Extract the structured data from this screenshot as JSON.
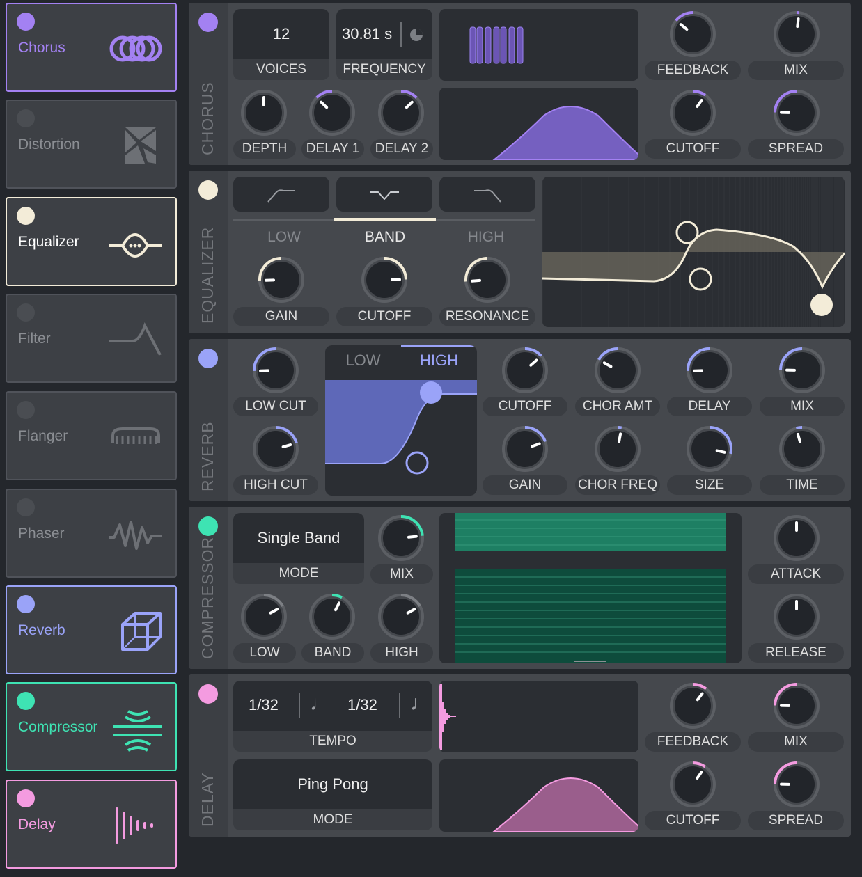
{
  "colors": {
    "chorus": "#a381f2",
    "equalizer": "#f3ecd8",
    "reverb": "#9aa3f8",
    "compressor": "#3ee3b3",
    "delay": "#f49be0"
  },
  "sidebar": {
    "items": [
      {
        "label": "Chorus",
        "icon": "chorus-rings-icon"
      },
      {
        "label": "Distortion",
        "icon": "distortion-shards-icon"
      },
      {
        "label": "Equalizer",
        "icon": "equalizer-eye-icon"
      },
      {
        "label": "Filter",
        "icon": "filter-curve-icon"
      },
      {
        "label": "Flanger",
        "icon": "flanger-comb-icon"
      },
      {
        "label": "Phaser",
        "icon": "phaser-wave-icon"
      },
      {
        "label": "Reverb",
        "icon": "reverb-cube-icon"
      },
      {
        "label": "Compressor",
        "icon": "compressor-arcs-icon"
      },
      {
        "label": "Delay",
        "icon": "delay-bars-icon"
      }
    ]
  },
  "chorus": {
    "title": "CHORUS",
    "voices": "12",
    "voices_label": "VOICES",
    "frequency": "30.81 s",
    "frequency_label": "FREQUENCY",
    "knobs": {
      "feedback": "FEEDBACK",
      "mix": "MIX",
      "depth": "DEPTH",
      "delay1": "DELAY 1",
      "delay2": "DELAY 2",
      "cutoff": "CUTOFF",
      "spread": "SPREAD"
    }
  },
  "equalizer": {
    "title": "EQUALIZER",
    "tabs": [
      "LOW",
      "BAND",
      "HIGH"
    ],
    "selected_tab": "BAND",
    "knobs": {
      "gain": "GAIN",
      "cutoff": "CUTOFF",
      "resonance": "RESONANCE"
    }
  },
  "reverb": {
    "title": "REVERB",
    "tabs": [
      "LOW",
      "HIGH"
    ],
    "selected_tab": "HIGH",
    "knobs": {
      "low_cut": "LOW CUT",
      "high_cut": "HIGH CUT",
      "cutoff": "CUTOFF",
      "chor_amt": "CHOR AMT",
      "delay": "DELAY",
      "mix": "MIX",
      "gain": "GAIN",
      "chor_freq": "CHOR FREQ",
      "size": "SIZE",
      "time": "TIME"
    }
  },
  "compressor": {
    "title": "COMPRESSOR",
    "mode": "Single Band",
    "mode_label": "MODE",
    "knobs": {
      "mix": "MIX",
      "low": "LOW",
      "band": "BAND",
      "high": "HIGH",
      "attack": "ATTACK",
      "release": "RELEASE"
    }
  },
  "delay": {
    "title": "DELAY",
    "tempo_left": "1/32",
    "tempo_right": "1/32",
    "tempo_label": "TEMPO",
    "note_icon": "♩",
    "mode": "Ping Pong",
    "mode_label": "MODE",
    "knobs": {
      "feedback": "FEEDBACK",
      "mix": "MIX",
      "cutoff": "CUTOFF",
      "spread": "SPREAD"
    }
  }
}
